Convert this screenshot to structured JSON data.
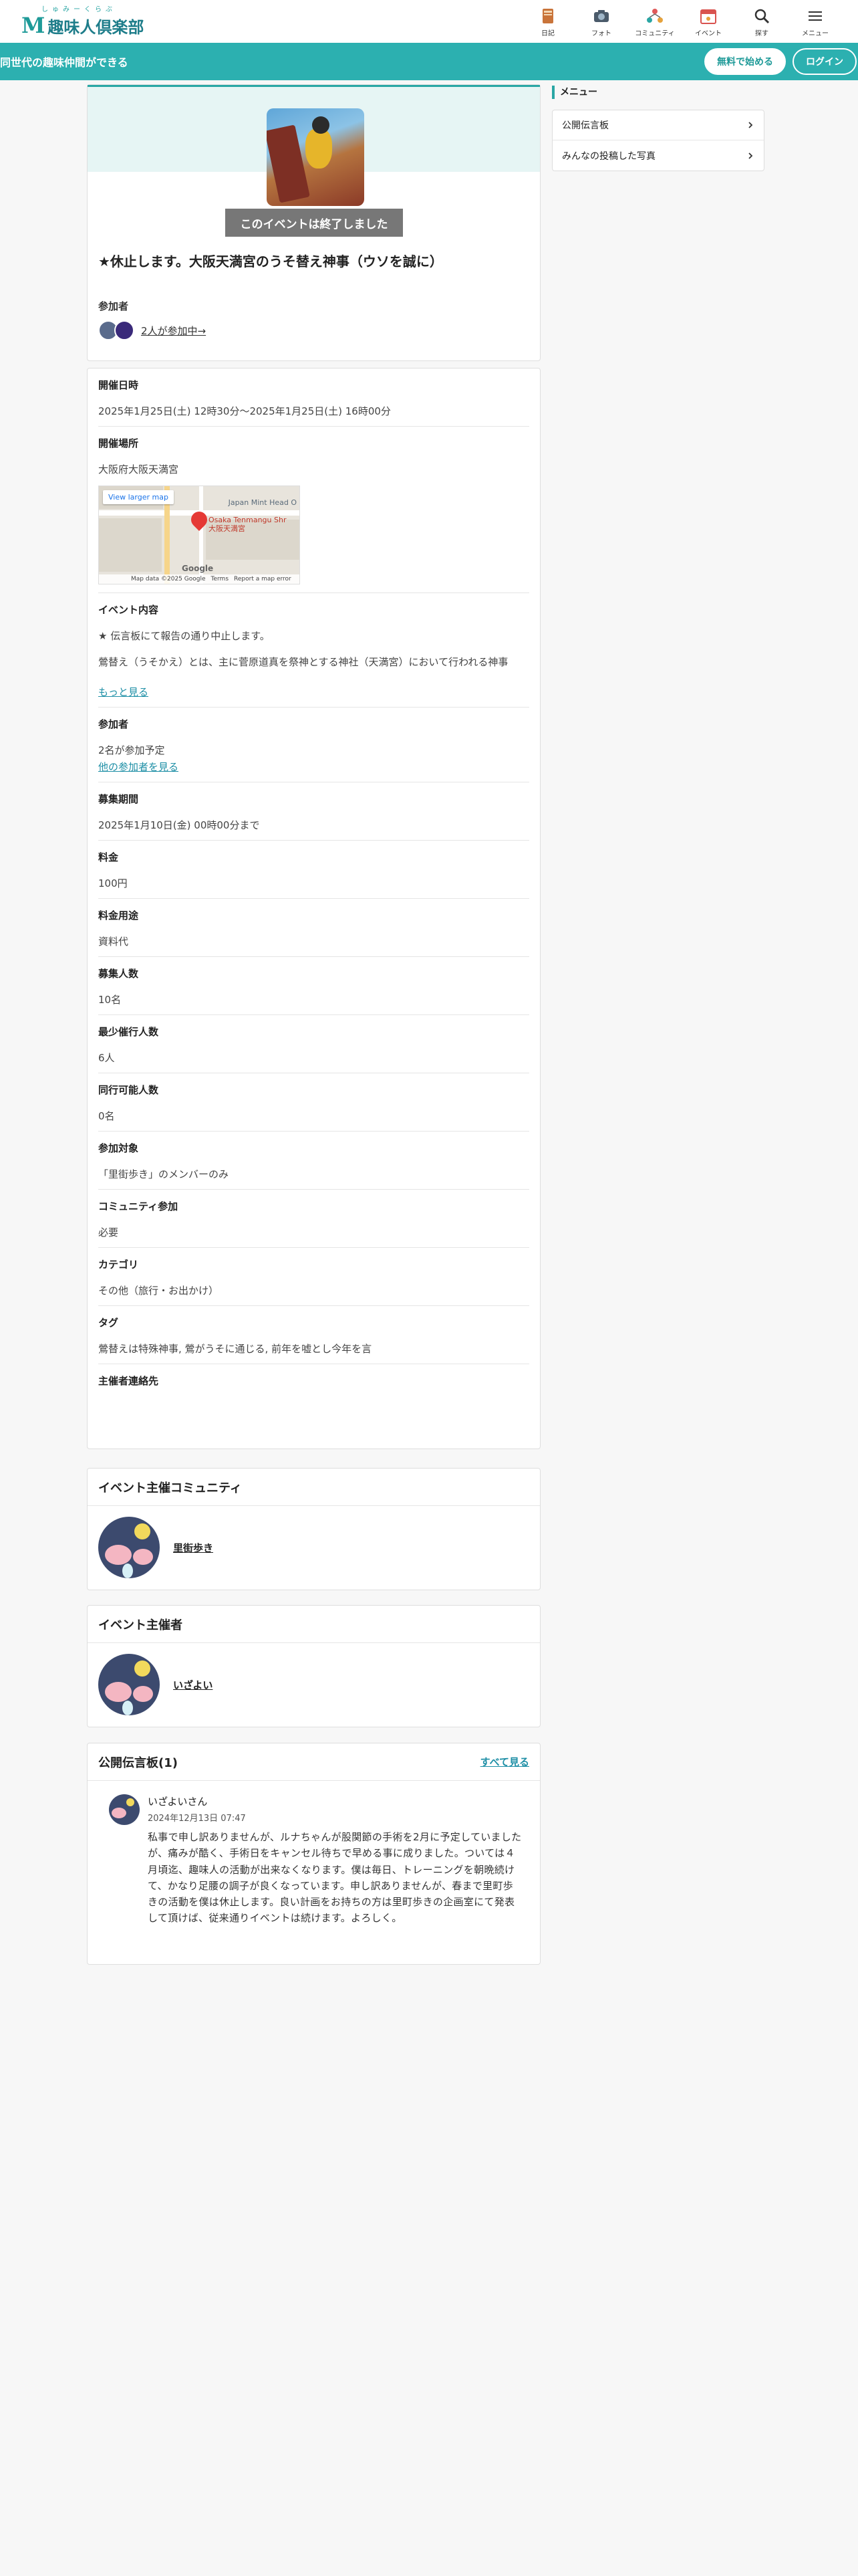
{
  "header": {
    "logo_ruby": "しゅみーくらぶ",
    "logo_name": "趣味人倶楽部",
    "nav": [
      {
        "label": "日記",
        "icon": "diary-icon"
      },
      {
        "label": "フォト",
        "icon": "camera-icon"
      },
      {
        "label": "コミュニティ",
        "icon": "community-icon"
      },
      {
        "label": "イベント",
        "icon": "calendar-icon"
      },
      {
        "label": "探す",
        "icon": "search-icon"
      },
      {
        "label": "メニュー",
        "icon": "menu-icon"
      }
    ]
  },
  "banner": {
    "tagline": "同世代の趣味仲間ができる",
    "signup": "無料で始める",
    "login": "ログイン"
  },
  "event": {
    "ended_label": "このイベントは終了しました",
    "title": "★休止します。大阪天満宮のうそ替え神事（ウソを誠に）",
    "participants_label": "参加者",
    "participants_link": "2人が参加中→"
  },
  "details": {
    "date_label": "開催日時",
    "date_value": "2025年1月25日(土) 12時30分〜2025年1月25日(土) 16時00分",
    "place_label": "開催場所",
    "place_value": "大阪府大阪天満宮",
    "map": {
      "view_larger": "View larger map",
      "pin_label": "Osaka Tenmangu Shr",
      "pin_sub": "大阪天満宮",
      "nearby": "Japan Mint Head O",
      "attrib": "Map data ©2025 Google",
      "terms": "Terms",
      "report": "Report a map error",
      "google": "Google"
    },
    "content_label": "イベント内容",
    "content_line1": "★ 伝言板にて報告の通り中止します。",
    "content_line2": "鶯替え（うそかえ）とは、主に菅原道真を祭神とする神社（天満宮）において行われる神事",
    "more": "もっと見る",
    "attendees_label": "参加者",
    "attendees_value": "2名が参加予定",
    "attendees_link": "他の参加者を見る",
    "period_label": "募集期間",
    "period_value": "2025年1月10日(金) 00時00分まで",
    "fee_label": "料金",
    "fee_value": "100円",
    "fee_use_label": "料金用途",
    "fee_use_value": "資料代",
    "capacity_label": "募集人数",
    "capacity_value": "10名",
    "min_label": "最少催行人数",
    "min_value": "6人",
    "companion_label": "同行可能人数",
    "companion_value": "0名",
    "target_label": "参加対象",
    "target_value": "「里街歩き」のメンバーのみ",
    "community_req_label": "コミュニティ参加",
    "community_req_value": "必要",
    "category_label": "カテゴリ",
    "category_value": "その他（旅行・お出かけ）",
    "tags_label": "タグ",
    "tags_value": "鶯替えは特殊神事, 鶯がうそに通じる, 前年を嘘とし今年を言",
    "contact_label": "主催者連絡先"
  },
  "host_community": {
    "heading": "イベント主催コミュニティ",
    "name": "里街歩き"
  },
  "host": {
    "heading": "イベント主催者",
    "name": "いざよい"
  },
  "board": {
    "heading": "公開伝言板(1)",
    "see_all": "すべて見る",
    "posts": [
      {
        "author": "いざよいさん",
        "date": "2024年12月13日 07:47",
        "text": "私事で申し訳ありませんが、ルナちゃんが股関節の手術を2月に予定していましたが、痛みが酷く、手術日をキャンセル待ちで早める事に成りました。ついては４月頃迄、趣味人の活動が出来なくなります。僕は毎日、トレーニングを朝晩続けて、かなり足腰の調子が良くなっています。申し訳ありませんが、春まで里町歩きの活動を僕は休止します。良い計画をお持ちの方は里町歩きの企画室にて発表して頂けば、従来通りイベントは続けます。よろしく。"
      }
    ]
  },
  "sidebar": {
    "heading": "メニュー",
    "items": [
      {
        "label": "公開伝言板"
      },
      {
        "label": "みんなの投稿した写真"
      }
    ]
  },
  "colors": {
    "accent": "#2cb0b0",
    "link": "#1e8fa6",
    "ended_bg": "#777777"
  }
}
